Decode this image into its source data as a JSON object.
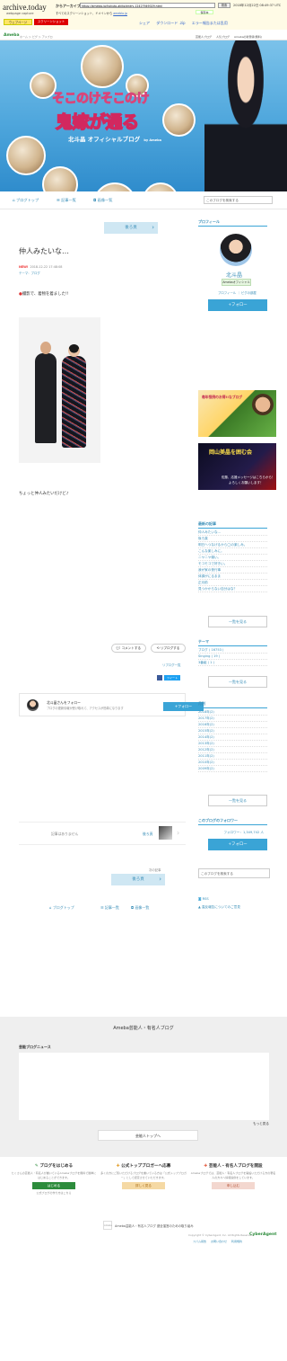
{
  "archive": {
    "logo": "archive.today",
    "subtitle": "webpage capture",
    "label": "からアーカイブ",
    "url": "https://ameblo.jp/hokuto-akiko/entry-12427949029.html",
    "search_btn": "検索",
    "date": "2018年12月22日 08:49:37 UTC",
    "save_btn": "保存本",
    "note_a": "すべてのスクリーンショット、ドメインから",
    "note_b": "ameblo.jp",
    "tab_webpage": "ウェブページ",
    "tab_screenshot": "スクリーンショット",
    "actions": [
      "シェア",
      "ダウンロード .zip",
      "エラー報告または乱用"
    ]
  },
  "ameba_bar": {
    "logo": "Ameba",
    "breadcrumb": "ホーム ＞ ピグ ＞ アメブロ",
    "links": [
      "芸能人ブログ",
      "人気ブログ",
      "Amebaの新登録(無料)"
    ]
  },
  "banner": {
    "title_line1": "そこのけそこのけ",
    "title_line2": "鬼嫁が通る",
    "subtitle": "北斗晶 オフィシャルブログ",
    "powered": "by Ameba"
  },
  "nav": {
    "items": [
      "ブログトップ",
      "記事一覧",
      "画像一覧"
    ],
    "search_placeholder": "このブログを検索する"
  },
  "entry": {
    "next_btn_top": "後ろ頁",
    "title": "仲人みたいな…",
    "new_label": "NEW!",
    "date": "2018-12-22 17:48:08",
    "theme": "テーマ：ブログ",
    "line1": "撮影で、着物を着ました!!",
    "line2": "ちょっと仲人みたいだけど♪",
    "comment_btn": "コメントする",
    "reblog_btn": "リブログする",
    "reblog_link": "リブログ一覧",
    "share_tweet": "ツイート"
  },
  "follow": {
    "name": "北斗晶さんをフォロー",
    "desc": "ブログの更新情報が受け取れて、アクセスが簡単になります",
    "btn": "+フォロー"
  },
  "pager": {
    "none": "記事はありません",
    "next": "後ろ頁",
    "page_num": "次の記事",
    "next_btn_bottom": "後ろ頁"
  },
  "bottom_nav": [
    "ブログトップ",
    "記事一覧",
    "画像一覧"
  ],
  "sidebar": {
    "profile_head": "プロフィール",
    "name": "北斗晶",
    "badge": "Amebaオフィシャル",
    "profile_links": "プロフィール ｜ ピグの部屋",
    "follow_btn": "+フォロー",
    "ad1_text": "毎年恒例のお得!!なブログ",
    "ad2_text1": "岡山美晶を囲む会",
    "ad2_text2": "佐藤、応援メッセージはこちらから！",
    "ad2_text3": "よろしくお願いします！",
    "recent_head": "最新の記事",
    "recent": [
      "仲人みたいな…",
      "後ろ頁",
      "明日へつなげるから◯の楽しみ。",
      "こんな楽しみに。",
      "ニヤニヤ働い。",
      "モコモコで好きい。",
      "我が家の夜行事",
      "体調がにるまま",
      "正月前",
      "見つかからない自分はな？"
    ],
    "recent_more": "一覧を見る",
    "theme_head": "テーマ",
    "themes": [
      {
        "name": "ブログ",
        "count": "( 16753 )"
      },
      {
        "name": "Singing",
        "count": "( 19 )"
      },
      {
        "name": "3番組",
        "count": "( 1 )"
      }
    ],
    "theme_more": "一覧を見る",
    "archive_head": "月別",
    "months": [
      "2018年(2)",
      "2017年(2)",
      "2016年(2)",
      "2015年(2)",
      "2014年(2)",
      "2013年(2)",
      "2012年(2)",
      "2011年(2)",
      "2010年(2)",
      "2009年(2)"
    ],
    "archive_more": "一覧を見る",
    "followers_head": "このブログのフォロワー",
    "followers": "フォロワー：1,349,742 人",
    "followers_btn": "+フォロー",
    "search_placeholder": "このブログを検索する",
    "rss": "RSS",
    "report": "違反報告についてのご意見"
  },
  "footer": {
    "title": "Ameba芸能人・有名人ブログ",
    "news_label": "芸能ブログニュース",
    "more": "もっと見る",
    "top_btn": "芸能人トップへ",
    "promos": [
      {
        "title": "ブログをはじめる",
        "desc": "たくさんの芸能人・有名人が書いているAmebaブログを無料で簡単にはじめることができます。",
        "btn": "はじめる",
        "link": "公式ブログの作り方はこちら"
      },
      {
        "title": "公式トップブロガーへ応募",
        "desc": "多くの方にご覧いただけるブログを書いている方は「公式トップブロガー」として認定させていただきます。",
        "btn": "詳しく見る",
        "link": ""
      },
      {
        "title": "芸能人・有名人ブログを開設",
        "desc": "Amebaブログでは、芸能人・有名人ブログを開設いただける方の著名人の方々へ情報提供をしています。",
        "btn": "申し込む",
        "link": ""
      }
    ],
    "app_logo": "Ameba",
    "app_text": "Ameba芸能人・有名人ブログ 健全運営のための取り組み",
    "copyright": "Copyright © CyberAgent, Inc. All Rights Reserved.",
    "cyber": "CyberAgent",
    "links": [
      "スパム報告",
      "お問い合わせ",
      "利用規約"
    ]
  },
  "colors": {
    "accent": "#3aa4d6",
    "link": "#3b8fb8",
    "ameba_green": "#2d8c3c",
    "banner_sky": "#4ea6dc"
  }
}
